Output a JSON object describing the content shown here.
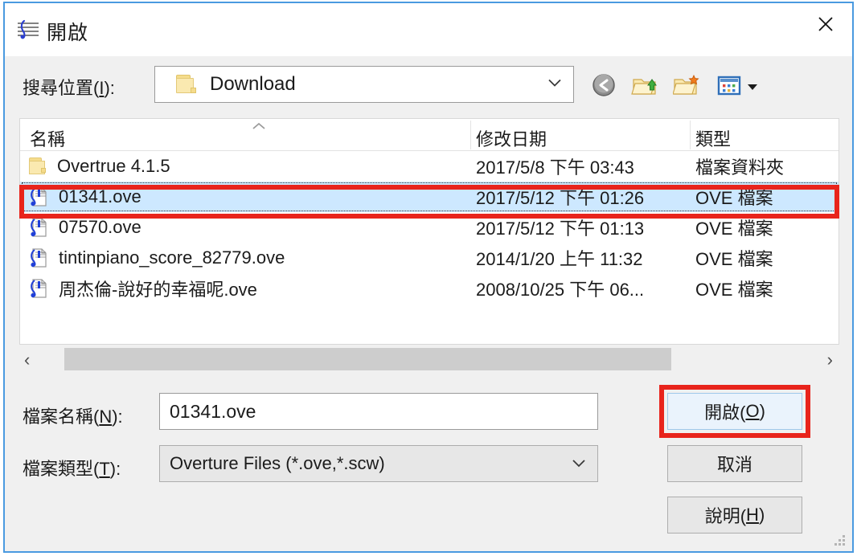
{
  "window": {
    "title": "開啟",
    "title_icon": "music-score-icon",
    "close_label": "×"
  },
  "lookin": {
    "label_prefix": "搜尋位置(",
    "label_accel": "I",
    "label_suffix": "):",
    "value": "Download",
    "folder_icon": "folder-icon",
    "dropdown_icon": "chevron-down-icon"
  },
  "toolbar": {
    "back": "back-icon",
    "up": "up-folder-icon",
    "new_folder": "new-folder-icon",
    "views": "views-icon",
    "views_dropdown": "caret-down-icon"
  },
  "file_list": {
    "columns": [
      "名稱",
      "修改日期",
      "類型"
    ],
    "sort_indicator": "ascending",
    "rows": [
      {
        "icon": "folder-icon",
        "name": "Overtrue 4.1.5",
        "date": "2017/5/8 下午 03:43",
        "type": "檔案資料夾",
        "selected": false
      },
      {
        "icon": "ove-file-icon",
        "name": "01341.ove",
        "date": "2017/5/12 下午 01:26",
        "type": "OVE 檔案",
        "selected": true
      },
      {
        "icon": "ove-file-icon",
        "name": "07570.ove",
        "date": "2017/5/12 下午 01:13",
        "type": "OVE 檔案",
        "selected": false
      },
      {
        "icon": "ove-file-icon",
        "name": "tintinpiano_score_82779.ove",
        "date": "2014/1/20 上午 11:32",
        "type": "OVE 檔案",
        "selected": false
      },
      {
        "icon": "ove-file-icon",
        "name": "周杰倫-說好的幸福呢.ove",
        "date": "2008/10/25 下午 06...",
        "type": "OVE 檔案",
        "selected": false
      }
    ]
  },
  "scrollbar": {
    "left_arrow": "‹",
    "right_arrow": "›"
  },
  "form": {
    "filename_label_prefix": "檔案名稱(",
    "filename_label_accel": "N",
    "filename_label_suffix": "):",
    "filename_value": "01341.ove",
    "filetype_label_prefix": "檔案類型(",
    "filetype_label_accel": "T",
    "filetype_label_suffix": "):",
    "filetype_value": "Overture Files (*.ove,*.scw)"
  },
  "buttons": {
    "open_prefix": "開啟(",
    "open_accel": "O",
    "open_suffix": ")",
    "cancel": "取消",
    "help_prefix": "說明(",
    "help_accel": "H",
    "help_suffix": ")"
  },
  "highlights": {
    "color": "#e8241c",
    "targets": [
      "selected-file-row",
      "open-button"
    ]
  }
}
